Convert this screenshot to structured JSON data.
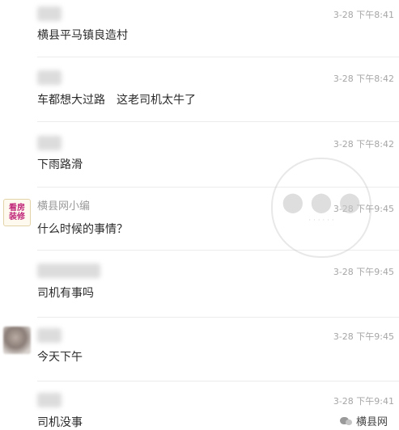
{
  "comments": [
    {
      "text": "横县平马镇良造村",
      "time": "3-28 下午8:41"
    },
    {
      "text": "车都想大过路　这老司机太牛了",
      "time": "3-28 下午8:42"
    },
    {
      "text": "下雨路滑",
      "time": "3-28 下午8:42"
    },
    {
      "name": "横县网小编",
      "avatar_text": [
        "看房",
        "装修"
      ],
      "text": "什么时候的事情？",
      "time": "3-28 下午9:45"
    },
    {
      "text": "司机有事吗",
      "time": "3-28 下午9:45"
    },
    {
      "text": "今天下午",
      "time": "3-28 下午9:45"
    },
    {
      "text": "司机没事",
      "time": "3-28 下午9:41"
    }
  ],
  "brand": {
    "label": "横县网"
  },
  "colors": {
    "text": "#2b2b2b",
    "muted": "#9a9a9a",
    "logo": "#c0287a"
  }
}
